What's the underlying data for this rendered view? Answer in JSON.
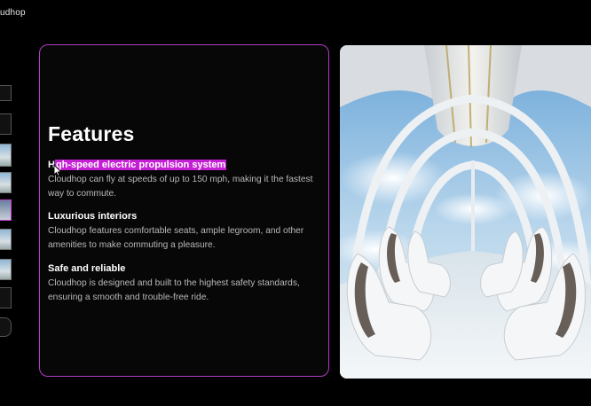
{
  "app": {
    "title": "udhop"
  },
  "slide": {
    "title": "Features",
    "features": [
      {
        "heading_prefix": "H",
        "heading_highlight": "gh-speed electric propulsion system",
        "description": "Cloudhop can fly at speeds of up to 150 mph, making it the fastest way to commute."
      },
      {
        "heading": "Luxurious interiors",
        "description": "Cloudhop features comfortable seats, ample legroom, and other amenities to make commuting a pleasure."
      },
      {
        "heading": "Safe and reliable",
        "description": "Cloudhop is designed and built to the highest safety standards, ensuring a smooth and trouble-free ride."
      }
    ]
  },
  "colors": {
    "accent": "#b33cc4",
    "highlight": "#c51fd6",
    "background": "#000000"
  },
  "icons": {
    "cursor": "pointer-cursor-icon"
  }
}
